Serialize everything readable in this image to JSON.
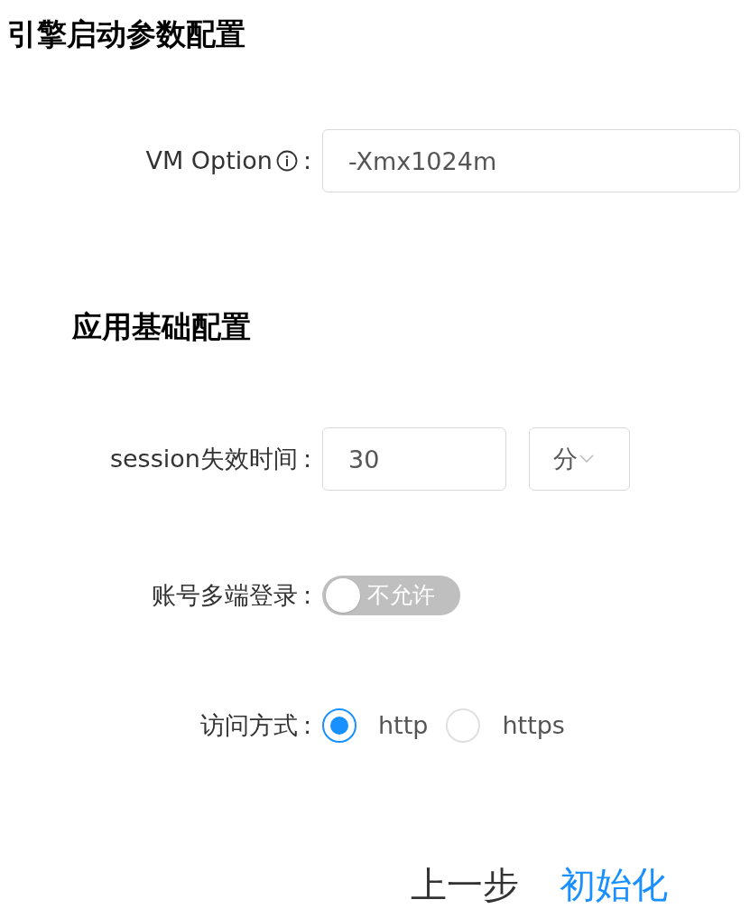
{
  "sections": [
    {
      "title": "引擎启动参数配置",
      "fields": [
        {
          "kind": "text",
          "label": "VM Option",
          "info": true,
          "colon": ":",
          "value": "-Xmx1024m"
        }
      ]
    },
    {
      "title": "应用基础配置",
      "fields": [
        {
          "kind": "duration",
          "label": "session失效时间",
          "colon": ":",
          "value": "30",
          "unit": "分"
        },
        {
          "kind": "switch",
          "label": "账号多端登录",
          "colon": ":",
          "on": false,
          "switch_text": "不允许"
        },
        {
          "kind": "radio",
          "label": "访问方式",
          "colon": ":",
          "options": [
            {
              "label": "http",
              "selected": true
            },
            {
              "label": "https",
              "selected": false
            }
          ]
        }
      ]
    }
  ],
  "buttons": [
    {
      "label": "上一步",
      "primary": false
    },
    {
      "label": "初始化",
      "primary": true
    }
  ]
}
